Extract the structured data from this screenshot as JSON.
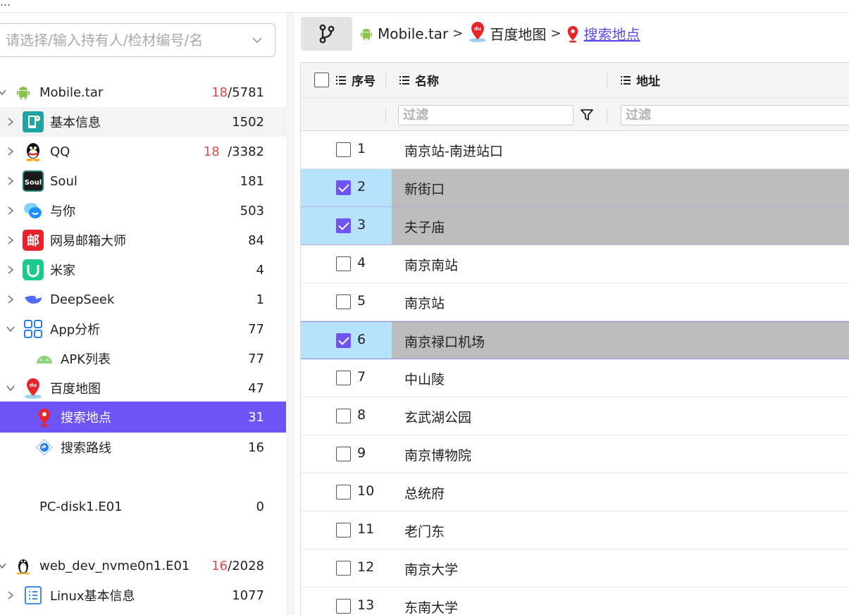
{
  "top_fragment": "…",
  "search": {
    "placeholder": "请选择/输入持有人/检材编号/名"
  },
  "tree": [
    {
      "label": "Mobile.tar",
      "count_red": "18",
      "count_rest": "/5781",
      "icon": "android-icon"
    },
    {
      "label": "基本信息",
      "count": "1502",
      "icon": "phone-info-icon"
    },
    {
      "label": "QQ",
      "count_red": "18",
      "count_rest": "  /3382",
      "icon": "qq-icon"
    },
    {
      "label": "Soul",
      "count": "181",
      "icon": "soul-icon"
    },
    {
      "label": "与你",
      "count": "503",
      "icon": "chat-bubble-icon"
    },
    {
      "label": "网易邮箱大师",
      "count": "84",
      "icon": "mail-master-icon"
    },
    {
      "label": "米家",
      "count": "4",
      "icon": "mijia-icon"
    },
    {
      "label": "DeepSeek",
      "count": "1",
      "icon": "deepseek-whale-icon"
    },
    {
      "label": "App分析",
      "count": "77",
      "icon": "grid-apps-icon"
    },
    {
      "label": "APK列表",
      "count": "77",
      "icon": "android-head-icon"
    },
    {
      "label": "百度地图",
      "count": "47",
      "icon": "baidu-map-icon"
    },
    {
      "label": "搜索地点",
      "count": "31",
      "icon": "location-pin-icon"
    },
    {
      "label": "搜索路线",
      "count": "16",
      "icon": "route-icon"
    },
    {
      "label": "PC-disk1.E01",
      "count": "0",
      "icon": ""
    },
    {
      "label": "web_dev_nvme0n1.E01",
      "count_red": "16",
      "count_rest": "/2028",
      "icon": "linux-tux-icon"
    },
    {
      "label": "Linux基本信息",
      "count": "1077",
      "icon": "list-doc-icon"
    }
  ],
  "breadcrumb": {
    "item1": "Mobile.tar",
    "item2": "百度地图",
    "item3": "搜索地点",
    "sep": ">"
  },
  "table": {
    "col_seq": "序号",
    "col_name": "名称",
    "col_addr": "地址",
    "filter_placeholder": "过滤",
    "rows": [
      {
        "seq": "1",
        "name": "南京站-南进站口",
        "checked": false
      },
      {
        "seq": "2",
        "name": "新街口",
        "checked": true
      },
      {
        "seq": "3",
        "name": "夫子庙",
        "checked": true
      },
      {
        "seq": "4",
        "name": "南京南站",
        "checked": false
      },
      {
        "seq": "5",
        "name": "南京站",
        "checked": false
      },
      {
        "seq": "6",
        "name": "南京禄口机场",
        "checked": true
      },
      {
        "seq": "7",
        "name": "中山陵",
        "checked": false
      },
      {
        "seq": "8",
        "name": "玄武湖公园",
        "checked": false
      },
      {
        "seq": "9",
        "name": "南京博物院",
        "checked": false
      },
      {
        "seq": "10",
        "name": "总统府",
        "checked": false
      },
      {
        "seq": "11",
        "name": "老门东",
        "checked": false
      },
      {
        "seq": "12",
        "name": "南京大学",
        "checked": false
      },
      {
        "seq": "13",
        "name": "东南大学",
        "checked": false
      }
    ]
  },
  "colors": {
    "accent": "#6e53f5",
    "red_count": "#e0484b",
    "row_select_left": "#b7e2fb",
    "row_select_right": "#bcbcbc"
  }
}
